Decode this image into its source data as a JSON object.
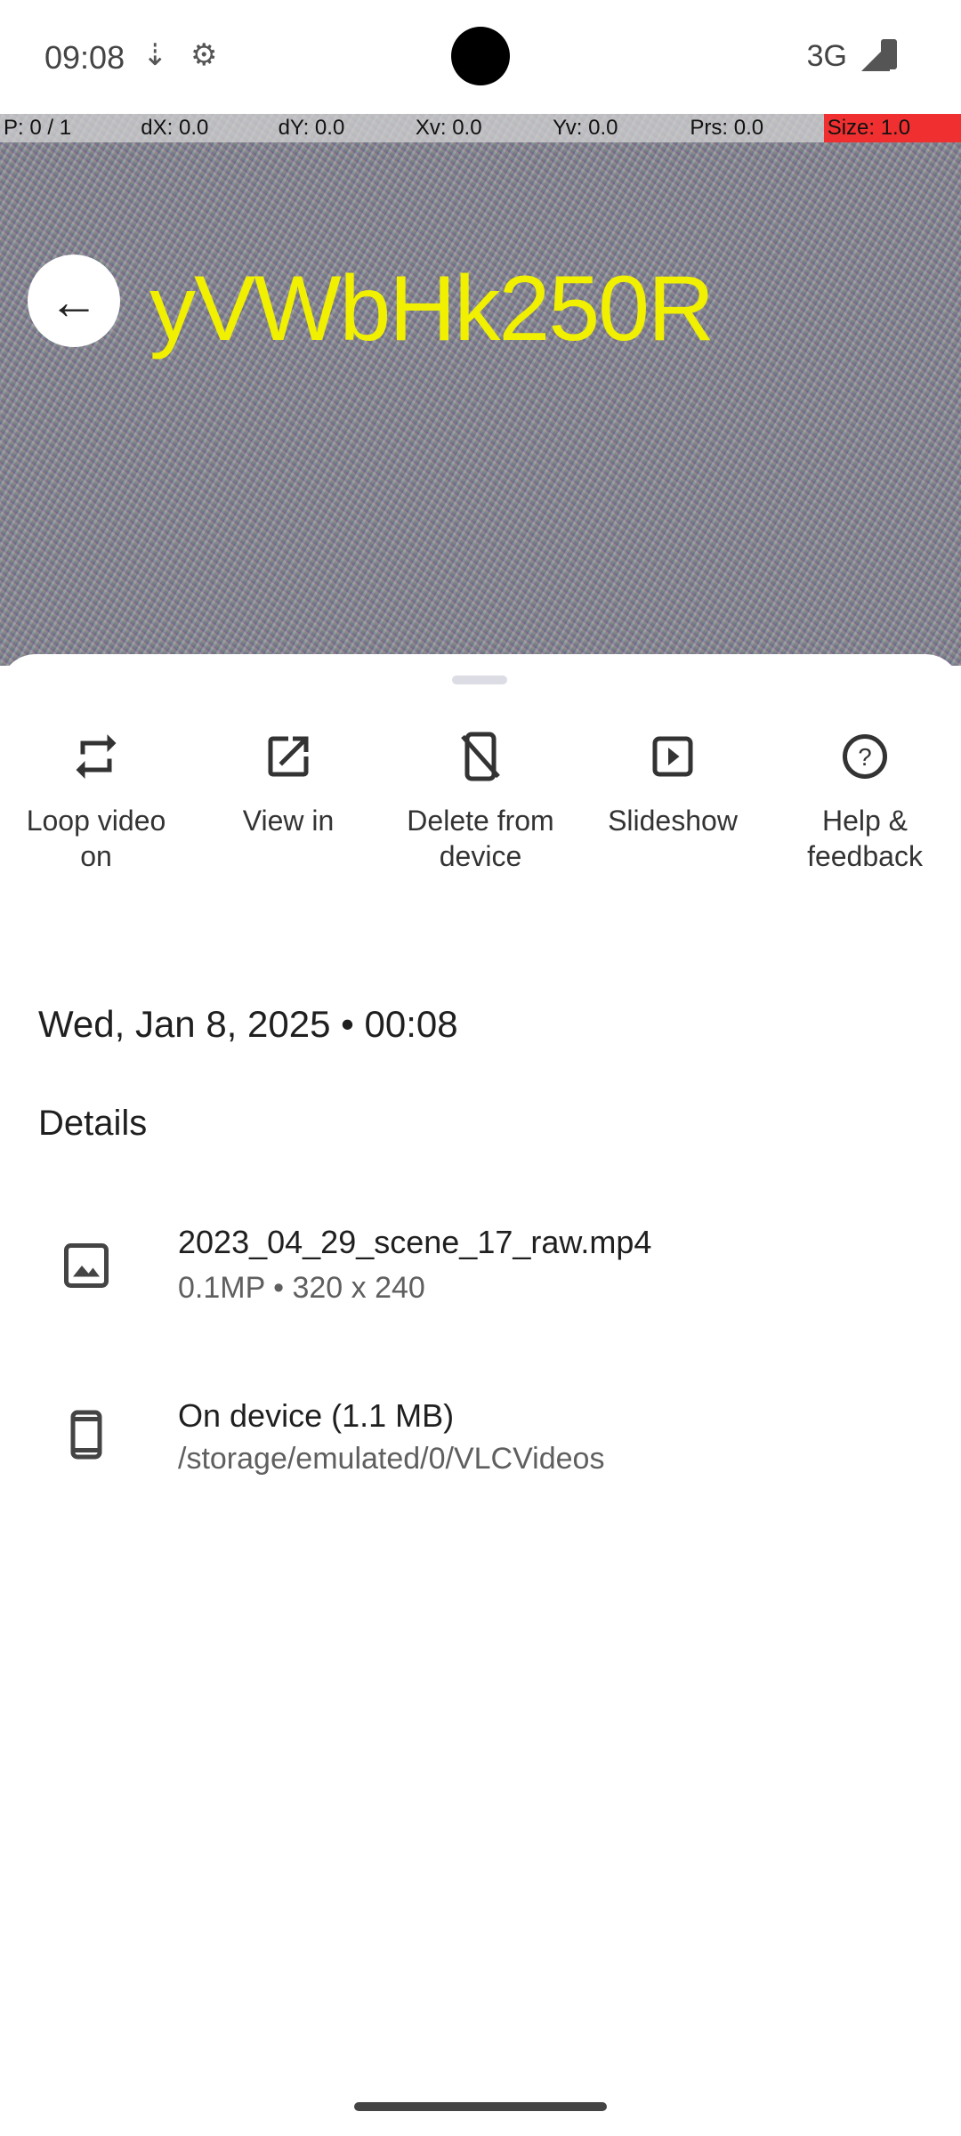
{
  "status_bar": {
    "time": "09:08",
    "network": "3G"
  },
  "debug_bar": {
    "p": "P: 0 / 1",
    "dx": "dX: 0.0",
    "dy": "dY: 0.0",
    "xv": "Xv: 0.0",
    "yv": "Yv: 0.0",
    "prs": "Prs: 0.0",
    "size": "Size: 1.0"
  },
  "media": {
    "overlay_text": "yVWbHk250R"
  },
  "actions": [
    {
      "label": "Loop video on",
      "icon": "repeat-icon"
    },
    {
      "label": "View in",
      "icon": "open-in-new-icon"
    },
    {
      "label": "Delete from device",
      "icon": "mobile-off-icon"
    },
    {
      "label": "Slideshow",
      "icon": "slideshow-icon"
    },
    {
      "label": "Help & feedback",
      "icon": "help-icon"
    }
  ],
  "date": "Wed, Jan 8, 2025 • 00:08",
  "details": {
    "heading": "Details",
    "file": {
      "title": "2023_04_29_scene_17_raw.mp4",
      "subtitle": "0.1MP • 320 x 240"
    },
    "location": {
      "title": "On device (1.1 MB)",
      "subtitle": "/storage/emulated/0/VLCVideos"
    }
  }
}
